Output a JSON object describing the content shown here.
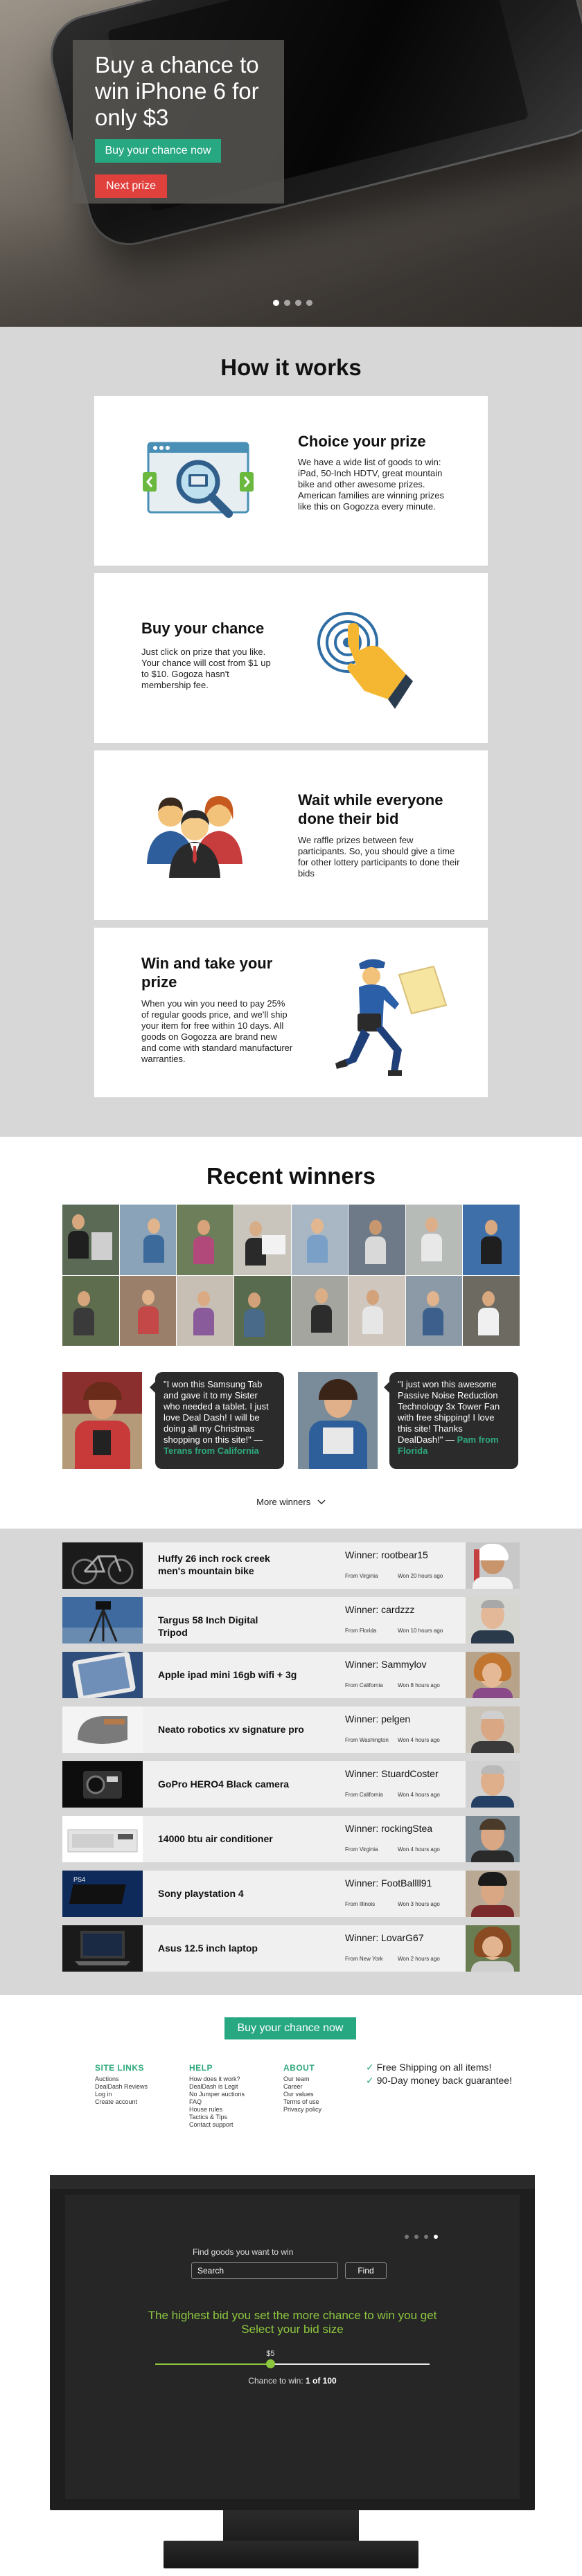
{
  "hero": {
    "title": "Buy a chance to win iPhone 6 for only $3",
    "cta": "Buy your chance now",
    "next": "Next prize",
    "slides": 4,
    "active_slide": 1
  },
  "how": {
    "title": "How it works",
    "steps": [
      {
        "title": "Choice your prize",
        "text": "We have a wide list of goods to win: iPad, 50-Inch HDTV, great mountain bike and other awesome prizes. American families are winning prizes like this on Gogozza every minute.",
        "icon": "browser-magnifier-icon"
      },
      {
        "title": "Buy your chance",
        "text": "Just click on prize that you like. Your chance will cost from $1 up to $10. Gogoza hasn't membership fee.",
        "icon": "hand-tap-icon"
      },
      {
        "title": "Wait while everyone done their bid",
        "text": "We raffle prizes between few participants. So, you should give a time for other lottery participants to done their bids",
        "icon": "people-group-icon"
      },
      {
        "title": "Win and take your prize",
        "text": "When you win you need to pay 25% of regular goods price, and we'll ship your item for free within 10 days. All goods on Gogozza are brand new and come with standard manufacturer warranties.",
        "icon": "courier-icon"
      }
    ]
  },
  "recent": {
    "title": "Recent winners",
    "testimonials": [
      {
        "quote": "\"I won this Samsung Tab and gave it to my Sister who needed a tablet. I just love Deal Dash! I will be doing all my Christmas shopping on this site!\"",
        "who": "Terans from California"
      },
      {
        "quote": "\"I just won this awesome Passive Noise Reduction Technology 3x Tower Fan with free shipping! I love this site! Thanks DealDash!\"",
        "who": "Pam from Florida"
      }
    ],
    "more": "More winners"
  },
  "winners": [
    {
      "product": "Huffy 26 inch rock creek men's mountain bike",
      "winner": "Winner: rootbear15",
      "from": "From Virginia",
      "time": "Won 20 hours ago"
    },
    {
      "product": "Targus 58 Inch Digital Tripod",
      "winner": "Winner: cardzzz",
      "from": "From Florida",
      "time": "Won 10 hours ago"
    },
    {
      "product": "Apple ipad mini 16gb wifi + 3g",
      "winner": "Winner: Sammylov",
      "from": "From California",
      "time": "Won 8 hours ago"
    },
    {
      "product": "Neato robotics xv signature pro",
      "winner": "Winner: pelgen",
      "from": "From Washington",
      "time": "Won 4 hours ago"
    },
    {
      "product": "GoPro HERO4 Black camera",
      "winner": "Winner: StuardCoster",
      "from": "From California",
      "time": "Won 4 hours ago"
    },
    {
      "product": "14000 btu air conditioner",
      "winner": "Winner: rockingStea",
      "from": "From Virginia",
      "time": "Won 4 hours ago"
    },
    {
      "product": "Sony playstation 4",
      "winner": "Winner: FootBallll91",
      "from": "From Illinois",
      "time": "Won 3 hours ago"
    },
    {
      "product": "Asus 12.5 inch laptop",
      "winner": "Winner: LovarG67",
      "from": "From New York",
      "time": "Won 2 hours ago"
    }
  ],
  "footer": {
    "cta": "Buy your chance now",
    "columns": [
      {
        "title": "SITE LINKS",
        "links": [
          "Auctions",
          "DealDash Reviews",
          "Log in",
          "Create account"
        ]
      },
      {
        "title": "HELP",
        "links": [
          "How does it work?",
          "DealDash is Legit",
          "No Jumper auctions",
          "FAQ",
          "House rules",
          "Tactics & Tips",
          "Contact support"
        ]
      },
      {
        "title": "ABOUT",
        "links": [
          "Our team",
          "Career",
          "Our values",
          "Terms of use",
          "Privacy policy"
        ]
      }
    ],
    "perks": [
      "Free Shipping on all items!",
      "90-Day money back guarantee!"
    ]
  },
  "screen": {
    "label": "Find goods you want to win",
    "search_value": "Search",
    "find": "Find",
    "headline": "The highest bid you set the more chance to win you get",
    "subheadline": "Select your bid size",
    "bid": "$5",
    "bid_fraction": 0.42,
    "chance_prefix": "Chance to win:",
    "chance_value": "1 of 100",
    "slides": 4,
    "active_slide": 4
  },
  "colors": {
    "accent": "#27a881",
    "danger": "#e0413c",
    "lime": "#8cc63f",
    "section_bg": "#d7d7d7"
  }
}
